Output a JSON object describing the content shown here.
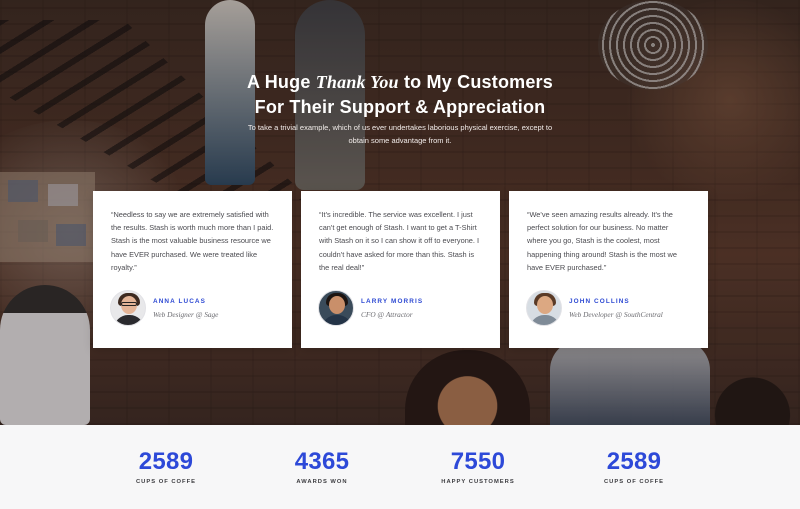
{
  "hero": {
    "title_line1_pre": "A Huge ",
    "title_line1_italic": "Thank You",
    "title_line1_post": " to My Customers",
    "title_line2": "For Their Support & Appreciation",
    "subtext": "To take a trivial example, which of us ever undertakes laborious physical exercise, except to obtain some advantage from it."
  },
  "testimonials": [
    {
      "quote": "“Needless to say we are extremely satisfied with the results. Stash is worth much more than I paid. Stash is the most valuable business resource we have EVER purchased. We were treated like royalty.”",
      "name": "ANNA LUCAS",
      "role": "Web Designer @ Sage"
    },
    {
      "quote": "“It's incredible. The service was excellent. I just can't get enough of Stash. I want to get a T-Shirt with Stash on it so I can show it off to everyone. I couldn't have asked for more than this. Stash is the real deal!”",
      "name": "LARRY MORRIS",
      "role": "CFO @ Attractor"
    },
    {
      "quote": "“We've seen amazing results already. It's the perfect solution for our business. No matter where you go, Stash is the coolest, most happening thing around! Stash is the most we have EVER purchased.”",
      "name": "JOHN COLLINS",
      "role": "Web Developer @ SouthCentral"
    }
  ],
  "stats": [
    {
      "value": "2589",
      "label": "CUPS OF COFFE"
    },
    {
      "value": "4365",
      "label": "AWARDS WON"
    },
    {
      "value": "7550",
      "label": "HAPPY CUSTOMERS"
    },
    {
      "value": "2589",
      "label": "CUPS OF COFFE"
    }
  ],
  "colors": {
    "accent": "#2d49d8",
    "card_bg": "#ffffff",
    "stats_bg": "#f7f7f8"
  }
}
